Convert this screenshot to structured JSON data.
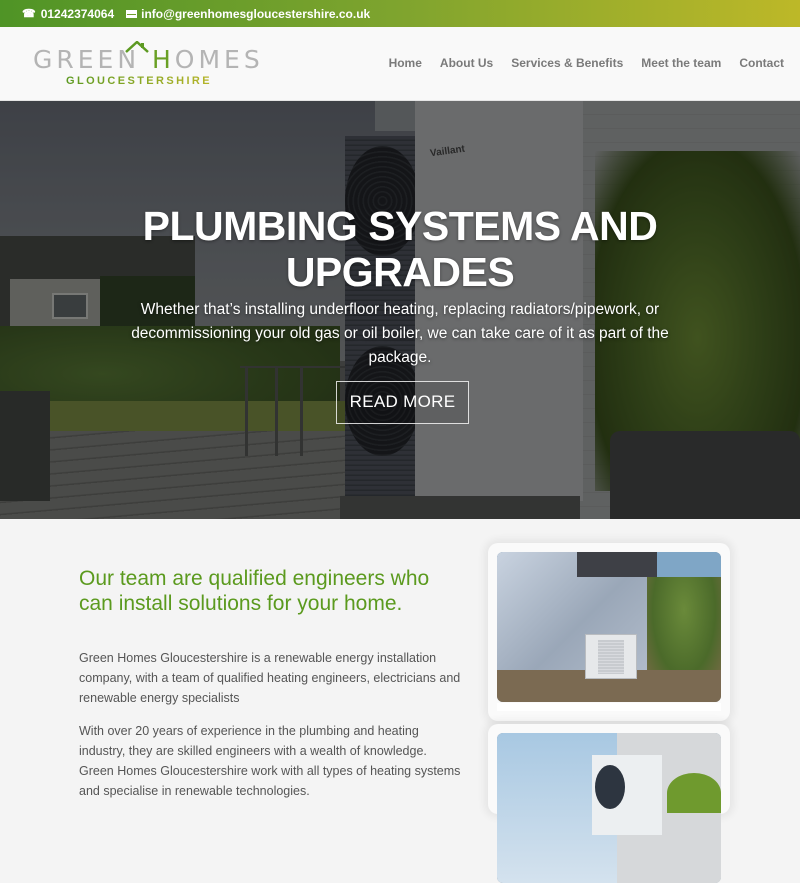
{
  "topbar": {
    "phone": "01242374064",
    "phone_icon": "phone-icon",
    "email": "info@greenhomesgloucestershire.co.uk",
    "email_icon": "envelope-icon",
    "gradient_colors": [
      "#4f9426",
      "#bdb828"
    ]
  },
  "header": {
    "logo": {
      "line1_part1": "GREEN ",
      "line1_h": "H",
      "line1_part2": "OMES",
      "line2": "GLOUCESTERSHIRE"
    },
    "nav": [
      {
        "label": "Home"
      },
      {
        "label": "About Us"
      },
      {
        "label": "Services & Benefits"
      },
      {
        "label": "Meet the team"
      },
      {
        "label": "Contact"
      }
    ]
  },
  "hero": {
    "title": "PLUMBING SYSTEMS AND UPGRADES",
    "description": "Whether that’s installing underfloor heating, replacing radiators/pipework, or decommissioning your old gas or oil boiler, we can take care of it as part of the package.",
    "button_label": "READ MORE",
    "image_brand_text": "Vaillant"
  },
  "about": {
    "heading": "Our team are qualified engineers who can install solutions for your home.",
    "paragraph1": "Green Homes Gloucestershire is a renewable energy installation company, with a team of qualified heating engineers, electricians and renewable energy specialists",
    "paragraph2": "With over 20 years of experience in the plumbing and heating industry, they are skilled engineers with a wealth of knowledge. Green Homes Gloucestershire work with all types of heating systems and specialise in renewable technologies.",
    "accent_color": "#5b9a1e"
  },
  "gallery": {
    "images": [
      {
        "alt": "heat-pump-beside-house"
      },
      {
        "alt": "heat-pump-unit-closeup"
      }
    ]
  }
}
